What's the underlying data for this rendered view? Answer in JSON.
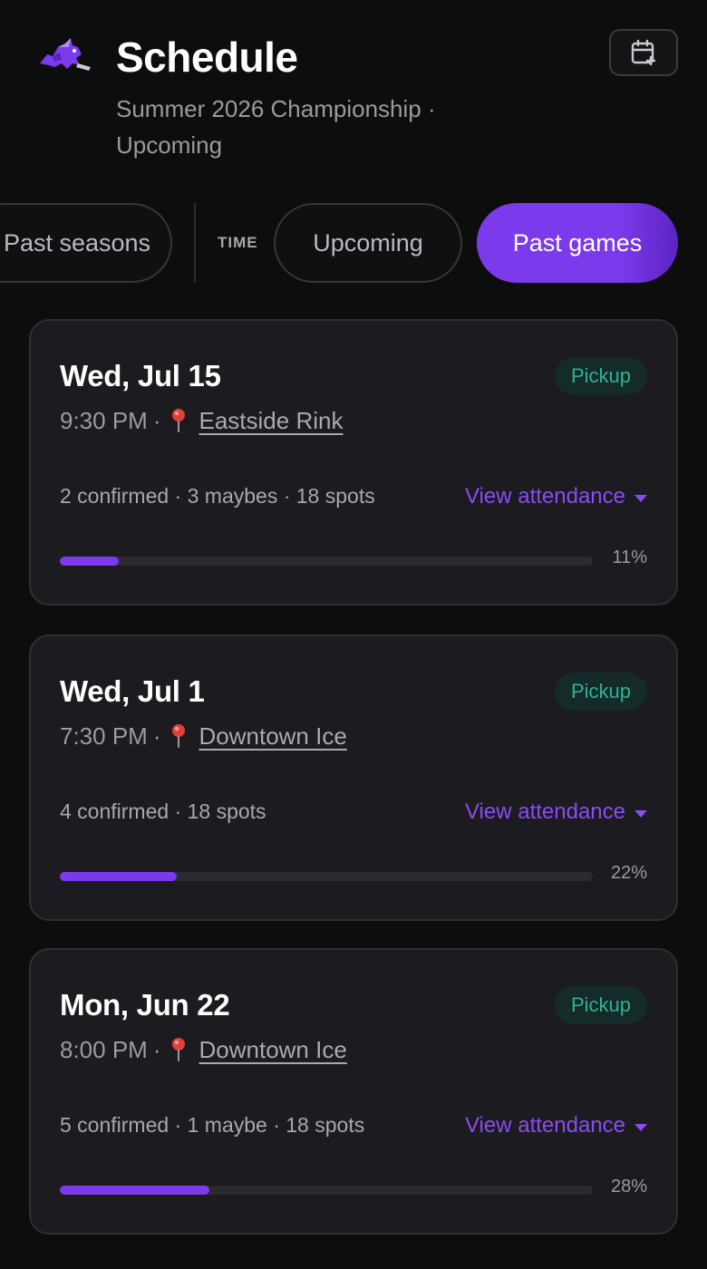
{
  "header": {
    "title": "Schedule",
    "subtitle": "Summer 2026 Championship · Upcoming",
    "logo_icon": "rhino-hockey-logo-icon",
    "calendar_button_icon": "calendar-plus-icon"
  },
  "filters": {
    "past_seasons_label": "Past seasons",
    "time_label": "TIME",
    "upcoming_label": "Upcoming",
    "past_games_label": "Past games",
    "selected": "Past games"
  },
  "colors": {
    "accent": "#7c3aed",
    "badge_text": "#2bb39a",
    "background": "#0d0d0e",
    "card": "#1b1b20"
  },
  "games": [
    {
      "date": "Wed, Jul 15",
      "time": "9:30 PM",
      "venue": "Eastside Rink",
      "badge": "Pickup",
      "stats": "2 confirmed · 3 maybes · 18 spots",
      "attendance_link": "View attendance",
      "progress": 0.11,
      "progress_label": "11%"
    },
    {
      "date": "Wed, Jul 1",
      "time": "7:30 PM",
      "venue": "Downtown Ice",
      "badge": "Pickup",
      "stats": "4 confirmed · 18 spots",
      "attendance_link": "View attendance",
      "progress": 0.22,
      "progress_label": "22%"
    },
    {
      "date": "Mon, Jun 22",
      "time": "8:00 PM",
      "venue": "Downtown Ice",
      "badge": "Pickup",
      "stats": "5 confirmed · 1 maybe · 18 spots",
      "attendance_link": "View attendance",
      "progress": 0.28,
      "progress_label": "28%"
    }
  ]
}
